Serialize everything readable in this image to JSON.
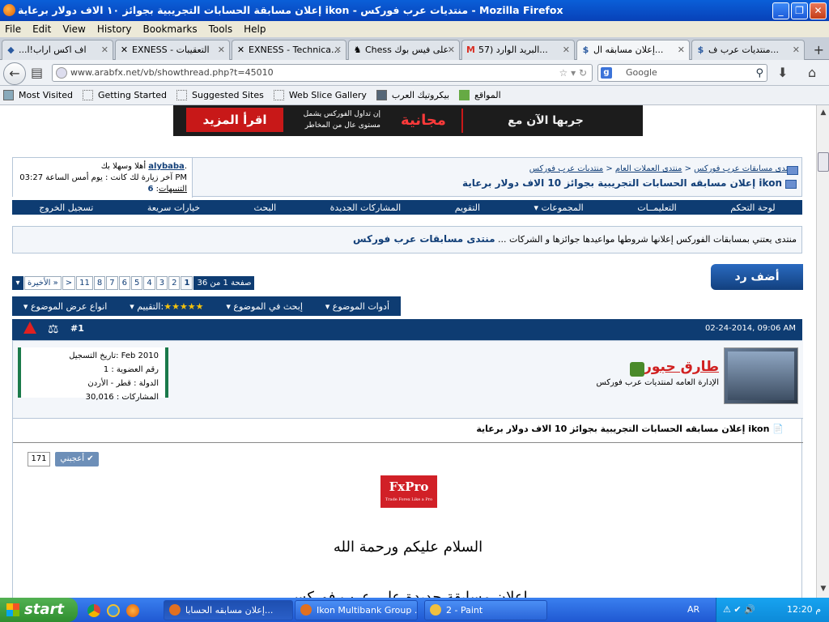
{
  "window": {
    "title": "إعلان مسابقة الحسابات التجريبية بجوائز ١٠ الاف دولار برعاية ikon - منتديات عرب فوركس - Mozilla Firefox"
  },
  "menu": [
    "File",
    "Edit",
    "View",
    "History",
    "Bookmarks",
    "Tools",
    "Help"
  ],
  "tabs": [
    {
      "label": "...اف اكس اراب!ا"
    },
    {
      "label": "EXNESS - التعقيبات"
    },
    {
      "label": "EXNESS - Technica..."
    },
    {
      "label": "Chess على فيس بوك"
    },
    {
      "label": "البريد الوارد (57..."
    },
    {
      "label": "إعلان مسابقه ال...",
      "active": true
    },
    {
      "label": "منتديات عرب ف..."
    }
  ],
  "nav": {
    "url": "www.arabfx.net/vb/showthread.php?t=45010",
    "search_placeholder": "Google"
  },
  "bookmarks": [
    "Most Visited",
    "Getting Started",
    "Suggested Sites",
    "Web Slice Gallery",
    "بيكروتيك العرب",
    "المواقع"
  ],
  "banner": {
    "more": "اقرأ المزيد",
    "slogan": "إن تداول الفوركس يشمل مستوى عال من المخاطر",
    "free": "مجانية",
    "try": "جربها الآن مع"
  },
  "welcome": {
    "greeting": "أهلا وسهلا بك",
    "username": "alybaba",
    "last_visit": "آخر زيارة لك كانت : يوم أمس الساعة 03:27 PM",
    "notices_label": "التنبيهات",
    "notices_count": "6"
  },
  "breadcrumb": {
    "home": "منتديات عرب فوركس",
    "general": "منتدى العملات العام",
    "contests": "منتدى مسابقات عرب فوركس",
    "thread": "إعلان مسابقه الحسابات التجريبية بجوائز 10 الاف دولار برعاية ikon"
  },
  "navstrip": [
    "لوحة التحكم",
    "التعليمــات",
    "المجموعات",
    "التقويم",
    "المشاركات الجديدة",
    "البحث",
    "خيارات سريعة",
    "تسجيل الخروج"
  ],
  "forum": {
    "name": "منتدى مسابقات عرب فوركس",
    "desc": "منتدى يعتني بمسابقات الفوركس إعلانها شروطها مواعيدها جوائزها و الشركات ..."
  },
  "reply_label": "أضف رد",
  "pager": {
    "summary": "صفحة 1 من 36",
    "pages": [
      "1",
      "2",
      "3",
      "4",
      "5",
      "6",
      "7",
      "8",
      "11"
    ],
    "next": ">",
    "last": "الأخيرة »"
  },
  "tools": {
    "display_modes": "انواع عرض الموضوع",
    "rating_label": "التقييم:",
    "search_thread": "إبحث في الموضوع",
    "thread_tools": "أدوات الموضوع"
  },
  "post": {
    "date": "02-24-2014, 09:06 AM",
    "number": "#1",
    "username": "طارق حبور",
    "role": "الإدارة العامه لمنتديات عرب فوركس",
    "stats": {
      "joined": "تاريخ التسجيل: Feb 2010",
      "member_no": "رقم العضوية : 1",
      "country": "الدولة : قطر - الأردن",
      "posts": "المشاركات : 30,016"
    },
    "title": "إعلان مسابقه الحسابات التجريبية بجوائز 10 الاف دولار برعاية ikon",
    "like_label": "أعجبني",
    "like_count": "171",
    "logo_text": "FxPro",
    "logo_sub": "Trade Forex Like a Pro",
    "greeting_text": "السلام عليكم ورحمة الله",
    "announce_text": "إعلان مسابقة جديدة على عرب فوركس"
  },
  "taskbar": {
    "start": "start",
    "items": [
      "إعلان مسابقه الحسابا...",
      "Ikon Multibank Group ...",
      "2 - Paint"
    ],
    "lang": "AR",
    "clock": "12:20 م"
  }
}
